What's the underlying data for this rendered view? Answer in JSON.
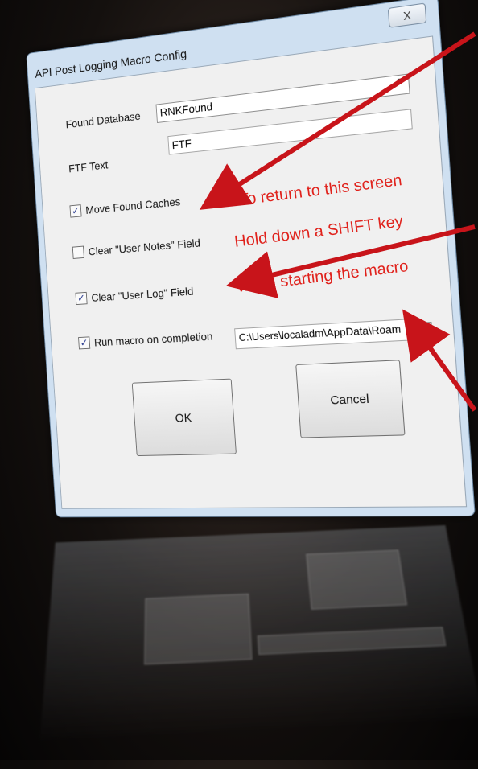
{
  "window": {
    "title": "API Post Logging Macro Config",
    "close_glyph": "X"
  },
  "fields": {
    "found_database": {
      "label": "Found Database",
      "value": "RNKFound"
    },
    "ftf_text": {
      "label": "FTF Text",
      "value": "FTF"
    }
  },
  "checkboxes": [
    {
      "label": "Move Found Caches",
      "checked": true
    },
    {
      "label": "Clear \"User Notes\" Field",
      "checked": false
    },
    {
      "label": "Clear \"User Log\" Field",
      "checked": true
    },
    {
      "label": "Run macro on completion",
      "checked": true
    }
  ],
  "macro_path": {
    "value": "C:\\Users\\localadm\\AppData\\Roam"
  },
  "buttons": {
    "ok": "OK",
    "cancel": "Cancel"
  },
  "annotation": {
    "lines": [
      "To return to this screen",
      "Hold down a SHIFT key",
      "when starting the macro"
    ],
    "color": "#e0221c"
  },
  "icons": {
    "browse": "folder-open-icon",
    "dropdown": "chevron-down-icon"
  }
}
